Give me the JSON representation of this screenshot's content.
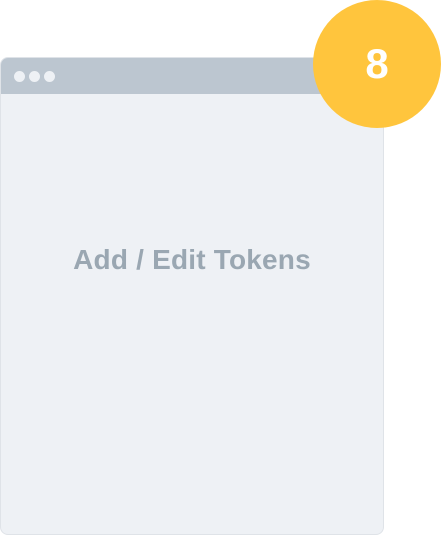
{
  "window": {
    "title": "Add / Edit Tokens",
    "dots": [
      "dot",
      "dot",
      "dot"
    ]
  },
  "badge": {
    "number": "8",
    "color": "#FFC53D"
  },
  "colors": {
    "titlebar": "#BCC6D0",
    "window_bg": "#EEF1F5",
    "title_text": "#9AA7B2"
  }
}
